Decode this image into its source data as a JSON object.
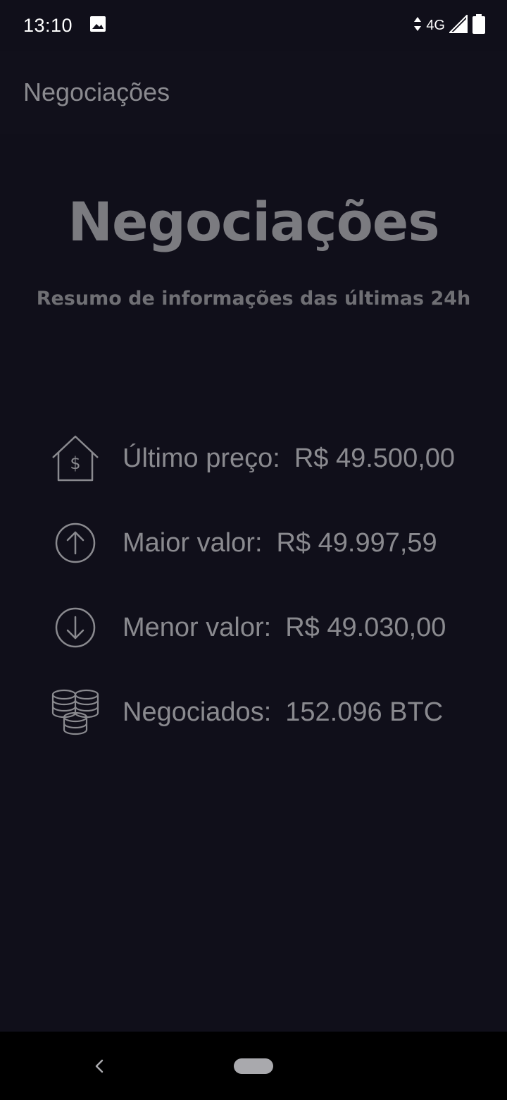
{
  "status_bar": {
    "time": "13:10",
    "network": "4G",
    "icons": [
      "image-icon",
      "data-arrows-icon",
      "signal-icon",
      "battery-icon"
    ]
  },
  "toolbar": {
    "title": "Negociações"
  },
  "hero": {
    "title": "Negociações",
    "subtitle": "Resumo de informações das últimas 24h"
  },
  "stats": [
    {
      "icon": "house-dollar-icon",
      "label": "Último preço:",
      "value": "R$ 49.500,00"
    },
    {
      "icon": "arrow-up-circle-icon",
      "label": "Maior valor:",
      "value": "R$ 49.997,59"
    },
    {
      "icon": "arrow-down-circle-icon",
      "label": "Menor valor:",
      "value": "R$ 49.030,00"
    },
    {
      "icon": "coins-stack-icon",
      "label": "Negociados:",
      "value": "152.096 BTC"
    }
  ],
  "colors": {
    "background": "#100f1a",
    "text": "#8a8a8f",
    "nav_bar": "#000000"
  }
}
